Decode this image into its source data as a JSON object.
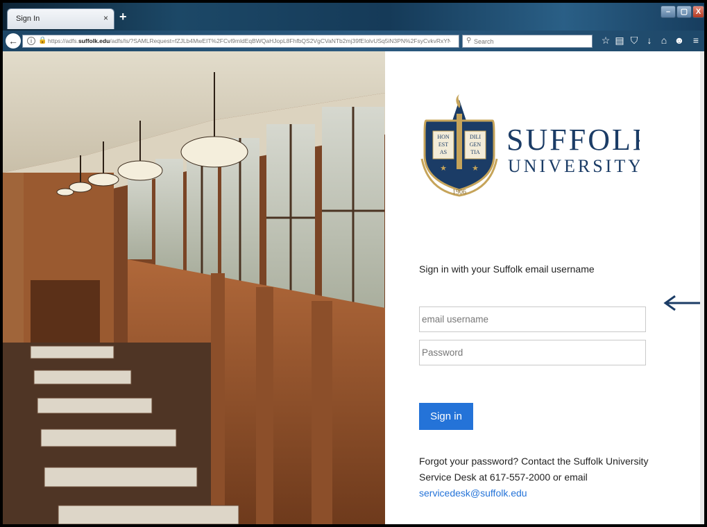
{
  "browser": {
    "tab_title": "Sign In",
    "tab_close": "×",
    "new_tab": "+",
    "url_prefix": "https://adfs.",
    "url_domain": "suffolk.edu",
    "url_rest": "/adfs/ls/?SAMLRequest=fZJLb4MwEIT%2FCvl9mldEqBWQaHJopL8FhfbQS2VgCVaNTb2mj39fEIolvUSq5iN3PN%2FsyCvkvRxYNtpOPcDbC",
    "search_placeholder": "Search",
    "window_buttons": {
      "minimize": "–",
      "maximize": "▢",
      "close": "X"
    },
    "toolbar_icons": [
      "star-icon",
      "reading-list-icon",
      "pocket-icon",
      "download-icon",
      "home-icon",
      "smiley-icon",
      "menu-icon"
    ]
  },
  "logo": {
    "name_line1": "SUFFOLK",
    "name_line2": "UNIVERSITY",
    "shield_words": [
      "HON",
      "EST",
      "AS",
      "DILI",
      "GEN",
      "TIA"
    ],
    "year": "1906",
    "colors": {
      "navy": "#1b3c66",
      "gold": "#c6a45a"
    }
  },
  "signin": {
    "heading": "Sign in with your Suffolk email username",
    "username_placeholder": "email username",
    "password_placeholder": "Password",
    "button_label": "Sign in",
    "help_text": "Forgot your password? Contact the Suffolk University Service Desk at 617-557-2000 or email",
    "help_email": "servicedesk@suffolk.edu"
  },
  "colors": {
    "accent": "#2473d8",
    "arrow": "#1b3c66"
  }
}
